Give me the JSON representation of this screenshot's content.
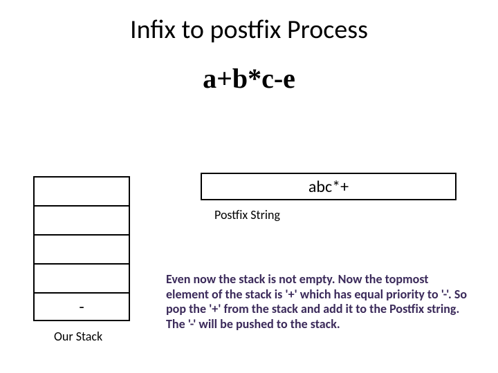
{
  "title": "Infix to postfix Process",
  "expression": "a+b*c-e",
  "postfixBox": "abc*+",
  "postfixLabel": "Postfix String",
  "stack": {
    "cells": [
      "",
      "",
      "",
      "",
      "-"
    ],
    "label": "Our Stack"
  },
  "explanation": "Even now the stack is not empty. Now the topmost element of the stack is '+' which has equal priority to '-'. So pop the '+' from the stack and add it to the Postfix string. The '-' will be pushed to the stack."
}
